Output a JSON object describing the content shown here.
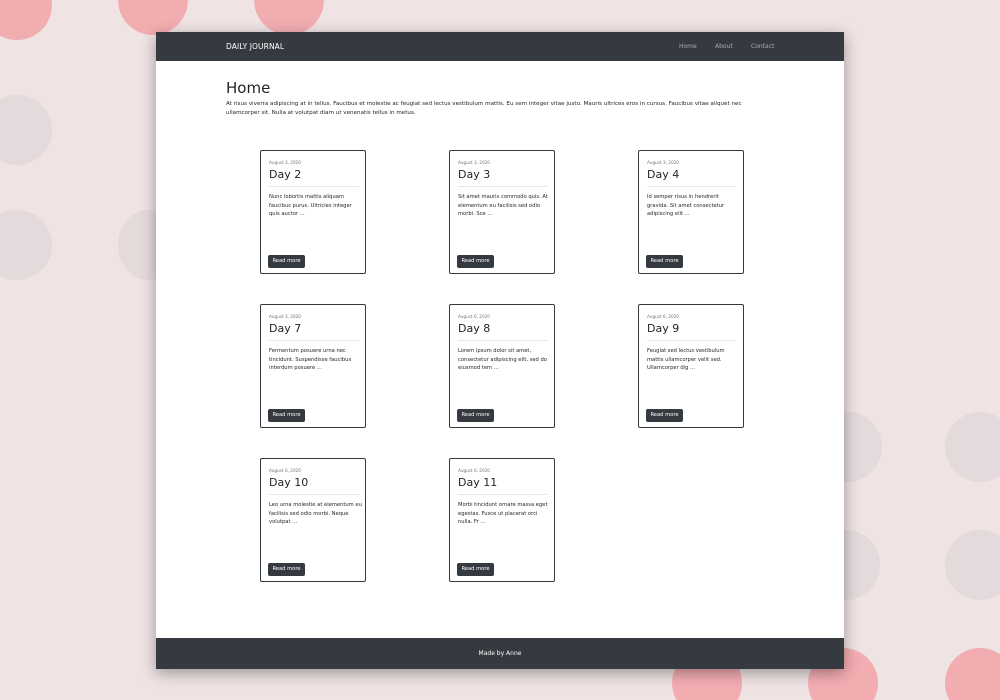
{
  "navbar": {
    "brand": "DAILY JOURNAL",
    "links": [
      "Home",
      "About",
      "Contact"
    ]
  },
  "main": {
    "title": "Home",
    "intro": "At risus viverra adipiscing at in tellus. Faucibus et molestie ac feugiat sed lectus vestibulum mattis. Eu sem integer vitae justo. Mauris ultrices eros in cursus. Faucibus vitae aliquet nec ullamcorper sit. Nulla at volutpat diam ut venenatis tellus in metus.",
    "cards": [
      {
        "date": "August 3, 2020",
        "title": "Day 2",
        "text": "Nunc lobortis mattis aliquam faucibus purus. Ultricies integer quis auctor ...",
        "button": "Read more"
      },
      {
        "date": "August 3, 2020",
        "title": "Day 3",
        "text": "Sit amet mauris commodo quis. At elementum eu facilisis sed odio morbi. Sce ...",
        "button": "Read more"
      },
      {
        "date": "August 3, 2020",
        "title": "Day 4",
        "text": "Id semper risus in hendrerit gravida. Sit amet consectetur adipiscing elit ...",
        "button": "Read more"
      },
      {
        "date": "August 3, 2020",
        "title": "Day 7",
        "text": "Fermentum posuere urna nec tincidunt. Suspendisse faucibus interdum posuere ...",
        "button": "Read more"
      },
      {
        "date": "August 6, 2020",
        "title": "Day 8",
        "text": "Lorem ipsum dolor sit amet, consectetur adipiscing elit, sed do eiusmod tem ...",
        "button": "Read more"
      },
      {
        "date": "August 6, 2020",
        "title": "Day 9",
        "text": "Feugiat sed lectus vestibulum mattis ullamcorper velit sed. Ullamcorper dig ...",
        "button": "Read more"
      },
      {
        "date": "August 6, 2020",
        "title": "Day 10",
        "text": "Leo urna molestie at elementum eu facilisis sed odio morbi. Neque volutpat ...",
        "button": "Read more"
      },
      {
        "date": "August 6, 2020",
        "title": "Day 11",
        "text": "Morbi tincidunt ornare massa eget egestas. Fusce ut placerat orci nulla. Fr ...",
        "button": "Read more"
      }
    ]
  },
  "footer": {
    "text": "Made by Anne"
  },
  "colors": {
    "navbar": "#343a40",
    "button": "#343a40",
    "background": "#efe3e4",
    "bubble_pink": "#f2a3a8"
  }
}
